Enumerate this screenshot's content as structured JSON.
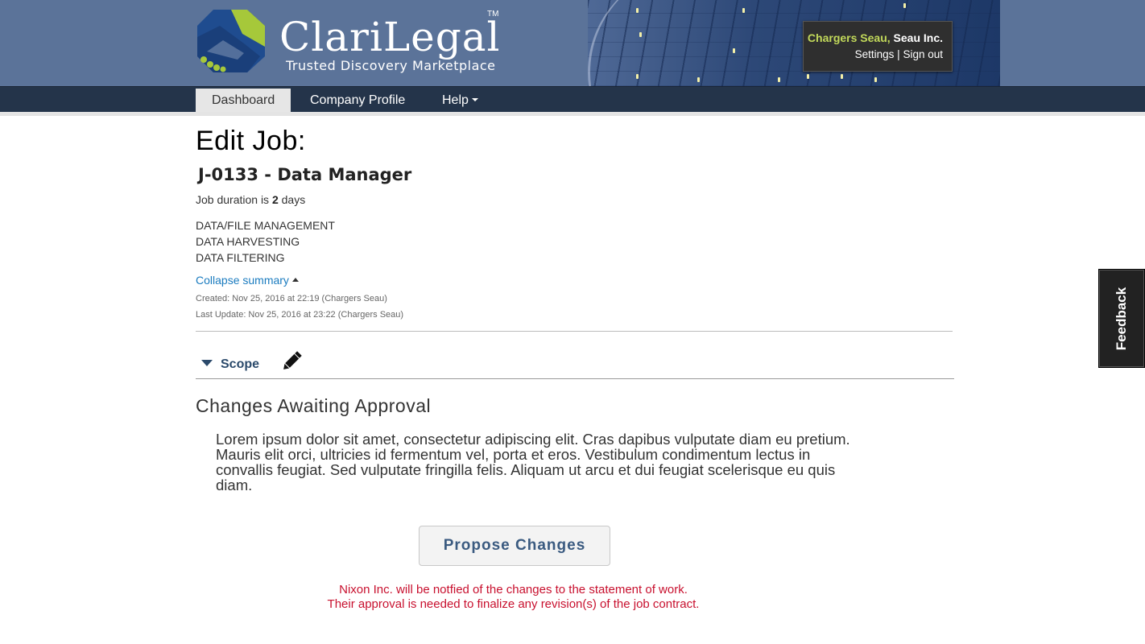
{
  "header": {
    "brand": "ClariLegal",
    "trademark": "TM",
    "tagline": "Trusted Discovery Marketplace",
    "user_name": "Chargers Seau,",
    "company": "Seau Inc.",
    "settings_label": "Settings",
    "separator": "|",
    "signout_label": "Sign out",
    "colors": {
      "header_bg": "#5b7399",
      "user_name": "#c2d95a",
      "logo_blue": "#1f4c8f",
      "logo_green": "#a6c83a"
    }
  },
  "nav": {
    "items": [
      {
        "label": "Dashboard",
        "active": true
      },
      {
        "label": "Company Profile",
        "active": false
      },
      {
        "label": "Help",
        "active": false,
        "icon": "caret-down-icon"
      }
    ]
  },
  "job": {
    "page_title": "Edit Job:",
    "name": "J-0133 - Data Manager",
    "duration_prefix": "Job duration is",
    "duration_value": "2",
    "duration_unit": "days",
    "services": [
      "DATA/FILE MANAGEMENT",
      "DATA HARVESTING",
      "DATA FILTERING"
    ],
    "collapse_label": "Collapse summary",
    "created": "Created: Nov 25, 2016 at 22:19 (Chargers Seau)",
    "updated": "Last Update: Nov 25, 2016 at 23:22 (Chargers Seau)"
  },
  "scope": {
    "label": "Scope",
    "edit_icon": "pencil-icon",
    "section_title": "Changes Awaiting Approval",
    "body": "Lorem ipsum dolor sit amet, consectetur adipiscing elit. Cras dapibus vulputate diam eu pretium. Mauris elit orci, ultricies id fermentum vel, porta et eros. Vestibulum condimentum lectus in convallis feugiat. Sed vulputate fringilla felis. Aliquam ut arcu et dui feugiat scelerisque eu quis diam.",
    "button_label": "Propose Changes",
    "notice_line1": "Nixon Inc. will be notfied of the changes to the statement of work.",
    "notice_line2": "Their approval is needed to finalize any revision(s) of the job contract.",
    "notice_color": "#c8102e"
  },
  "feedback": {
    "label": "Feedback"
  }
}
